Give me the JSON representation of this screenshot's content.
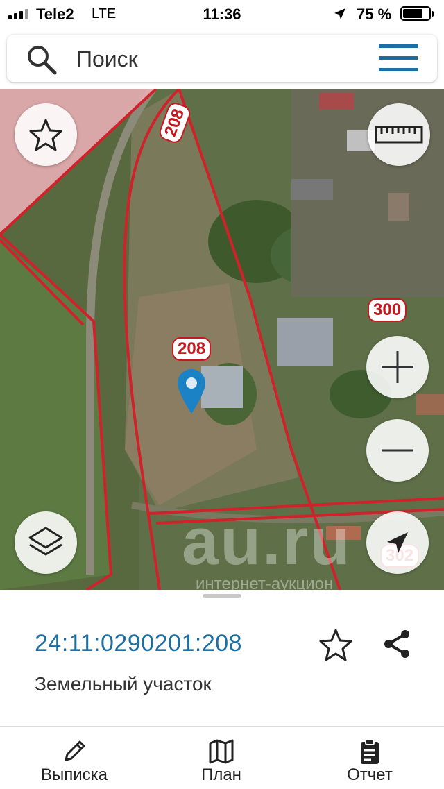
{
  "status_bar": {
    "carrier": "Tele2",
    "network": "LTE",
    "time": "11:36",
    "battery_percent": "75 %",
    "battery_level": 0.75
  },
  "search": {
    "placeholder": "Поиск",
    "search_icon": "search-icon",
    "menu_icon": "hamburger-menu-icon"
  },
  "map": {
    "parcel_labels": [
      "208",
      "208",
      "300",
      "302"
    ],
    "watermark": "au.ru",
    "watermark_sub": "интернет-аукцион",
    "controls": {
      "favorite_icon": "star-icon",
      "ruler_icon": "ruler-icon",
      "zoom_in_icon": "plus-icon",
      "zoom_out_icon": "minus-icon",
      "layers_icon": "layers-icon",
      "locate_icon": "navigation-arrow-icon"
    },
    "colors": {
      "boundary": "#d0222a",
      "marker": "#1b82c6"
    }
  },
  "details": {
    "cadastral_number": "24:11:0290201:208",
    "property_type": "Земельный участок",
    "accent": "#1b6fa4"
  },
  "tabs": [
    {
      "label": "Выписка",
      "icon": "pencil-icon"
    },
    {
      "label": "План",
      "icon": "map-icon"
    },
    {
      "label": "Отчет",
      "icon": "clipboard-icon"
    }
  ]
}
